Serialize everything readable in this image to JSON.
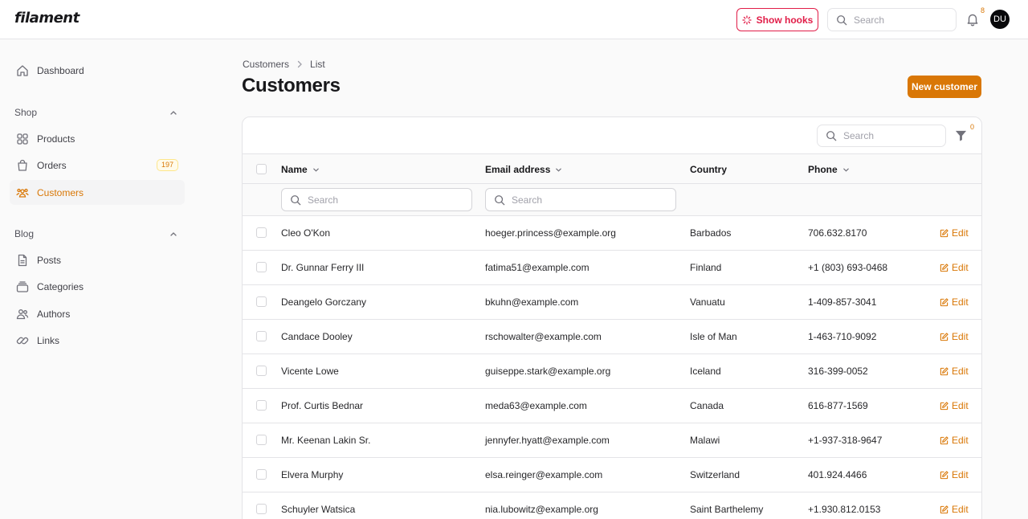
{
  "app": {
    "logo": "filament"
  },
  "topbar": {
    "hooks_label": "Show hooks",
    "search_placeholder": "Search",
    "notification_count": "8",
    "avatar_initials": "DU"
  },
  "sidebar": {
    "dashboard": "Dashboard",
    "groups": [
      {
        "label": "Shop",
        "items": [
          {
            "label": "Products",
            "icon": "products-icon"
          },
          {
            "label": "Orders",
            "icon": "orders-icon",
            "badge": "197"
          },
          {
            "label": "Customers",
            "icon": "customers-icon",
            "active": true
          }
        ]
      },
      {
        "label": "Blog",
        "items": [
          {
            "label": "Posts",
            "icon": "posts-icon"
          },
          {
            "label": "Categories",
            "icon": "categories-icon"
          },
          {
            "label": "Authors",
            "icon": "authors-icon"
          },
          {
            "label": "Links",
            "icon": "links-icon"
          }
        ]
      }
    ]
  },
  "breadcrumb": [
    "Customers",
    "List"
  ],
  "page": {
    "title": "Customers",
    "new_button": "New customer"
  },
  "table": {
    "search_placeholder": "Search",
    "filter_count": "0",
    "columns": [
      "Name",
      "Email address",
      "Country",
      "Phone"
    ],
    "column_search_placeholder": "Search",
    "edit_label": "Edit",
    "rows": [
      {
        "name": "Cleo O'Kon",
        "email": "hoeger.princess@example.org",
        "country": "Barbados",
        "phone": "706.632.8170"
      },
      {
        "name": "Dr. Gunnar Ferry III",
        "email": "fatima51@example.com",
        "country": "Finland",
        "phone": "+1 (803) 693-0468"
      },
      {
        "name": "Deangelo Gorczany",
        "email": "bkuhn@example.com",
        "country": "Vanuatu",
        "phone": "1-409-857-3041"
      },
      {
        "name": "Candace Dooley",
        "email": "rschowalter@example.com",
        "country": "Isle of Man",
        "phone": "1-463-710-9092"
      },
      {
        "name": "Vicente Lowe",
        "email": "guiseppe.stark@example.org",
        "country": "Iceland",
        "phone": "316-399-0052"
      },
      {
        "name": "Prof. Curtis Bednar",
        "email": "meda63@example.com",
        "country": "Canada",
        "phone": "616-877-1569"
      },
      {
        "name": "Mr. Keenan Lakin Sr.",
        "email": "jennyfer.hyatt@example.com",
        "country": "Malawi",
        "phone": "+1-937-318-9647"
      },
      {
        "name": "Elvera Murphy",
        "email": "elsa.reinger@example.com",
        "country": "Switzerland",
        "phone": "401.924.4466"
      },
      {
        "name": "Schuyler Watsica",
        "email": "nia.lubowitz@example.org",
        "country": "Saint Barthelemy",
        "phone": "+1.930.812.0153"
      }
    ]
  },
  "colors": {
    "accent": "#d97706",
    "danger": "#e11d48"
  }
}
